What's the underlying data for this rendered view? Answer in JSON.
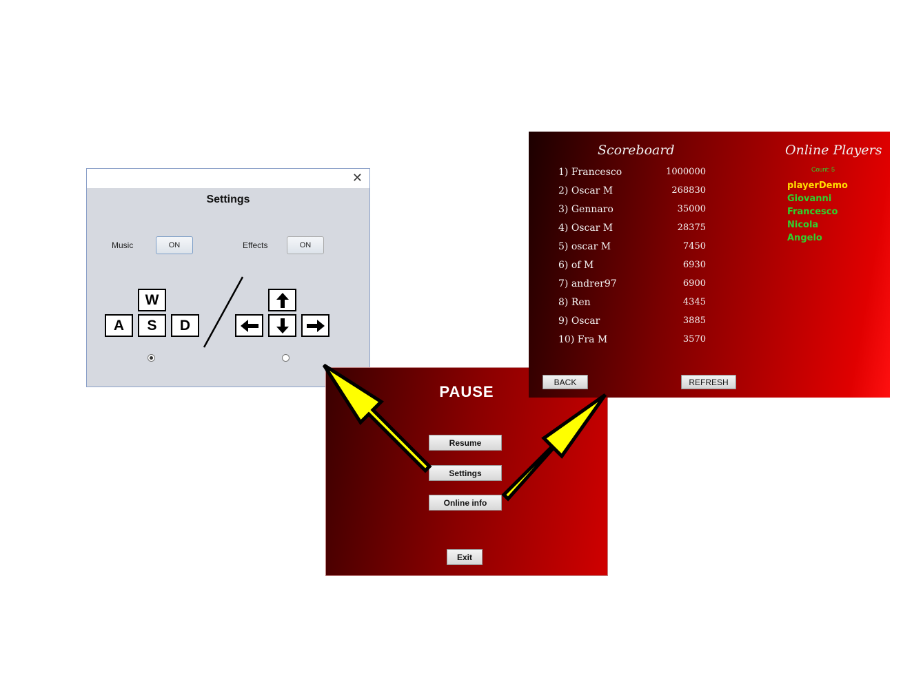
{
  "settings": {
    "title": "Settings",
    "close_glyph": "✕",
    "music_label": "Music",
    "music_toggle": "ON",
    "effects_label": "Effects",
    "effects_toggle": "ON",
    "wasd_keys": [
      "W",
      "A",
      "S",
      "D"
    ],
    "arrow_key_icons": [
      "arrow-up-icon",
      "arrow-left-icon",
      "arrow-down-icon",
      "arrow-right-icon"
    ],
    "selected_scheme": "wasd"
  },
  "pause": {
    "title": "PAUSE",
    "buttons": {
      "resume": "Resume",
      "settings": "Settings",
      "online_info": "Online info",
      "exit": "Exit"
    }
  },
  "scoreboard": {
    "title": "Scoreboard",
    "entries": [
      {
        "name": "1) Francesco",
        "points": "1000000"
      },
      {
        "name": "2) Oscar M",
        "points": "268830"
      },
      {
        "name": "3) Gennaro",
        "points": "35000"
      },
      {
        "name": "4) Oscar M",
        "points": "28375"
      },
      {
        "name": "5) oscar M",
        "points": "7450"
      },
      {
        "name": "6) of M",
        "points": "6930"
      },
      {
        "name": "7) andrer97",
        "points": "6900"
      },
      {
        "name": "8) Ren",
        "points": "4345"
      },
      {
        "name": "9) Oscar",
        "points": "3885"
      },
      {
        "name": "10) Fra M",
        "points": "3570"
      }
    ],
    "back_label": "BACK",
    "refresh_label": "REFRESH"
  },
  "online": {
    "title": "Online Players",
    "count": "Count: 5",
    "players": [
      {
        "name": "playerDemo",
        "color": "#ffe000"
      },
      {
        "name": "Giovanni",
        "color": "#2ed32e"
      },
      {
        "name": "Francesco",
        "color": "#2ed32e"
      },
      {
        "name": "Nicola",
        "color": "#2ed32e"
      },
      {
        "name": "Angelo",
        "color": "#2ed32e"
      }
    ]
  },
  "colors": {
    "arrow_fill": "#ffff00",
    "arrow_outline": "#000000"
  }
}
